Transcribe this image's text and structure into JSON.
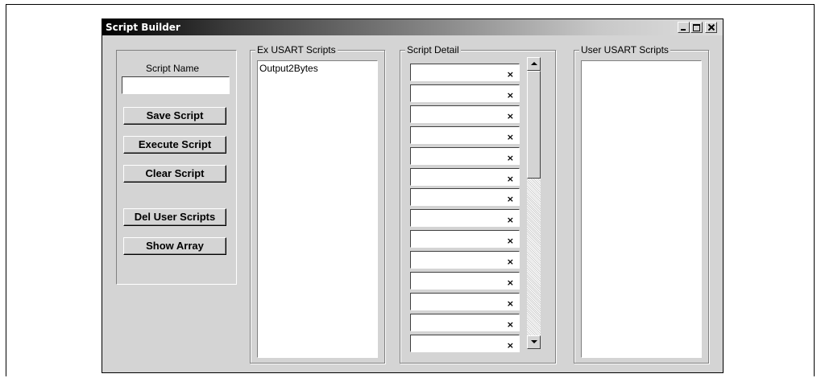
{
  "window": {
    "title": "Script Builder"
  },
  "left_panel": {
    "script_name_label": "Script Name",
    "script_name_value": "",
    "buttons": {
      "save": "Save Script",
      "execute": "Execute Script",
      "clear": "Clear Script",
      "del_user": "Del User Scripts",
      "show_array": "Show Array"
    }
  },
  "ex_scripts": {
    "title": "Ex USART Scripts",
    "items": [
      "Output2Bytes"
    ]
  },
  "script_detail": {
    "title": "Script Detail",
    "row_x": [
      "×",
      "×",
      "×",
      "×",
      "×",
      "×",
      "×",
      "×",
      "×",
      "×",
      "×",
      "×",
      "×",
      "×"
    ]
  },
  "user_scripts": {
    "title": "User USART Scripts",
    "items": []
  }
}
